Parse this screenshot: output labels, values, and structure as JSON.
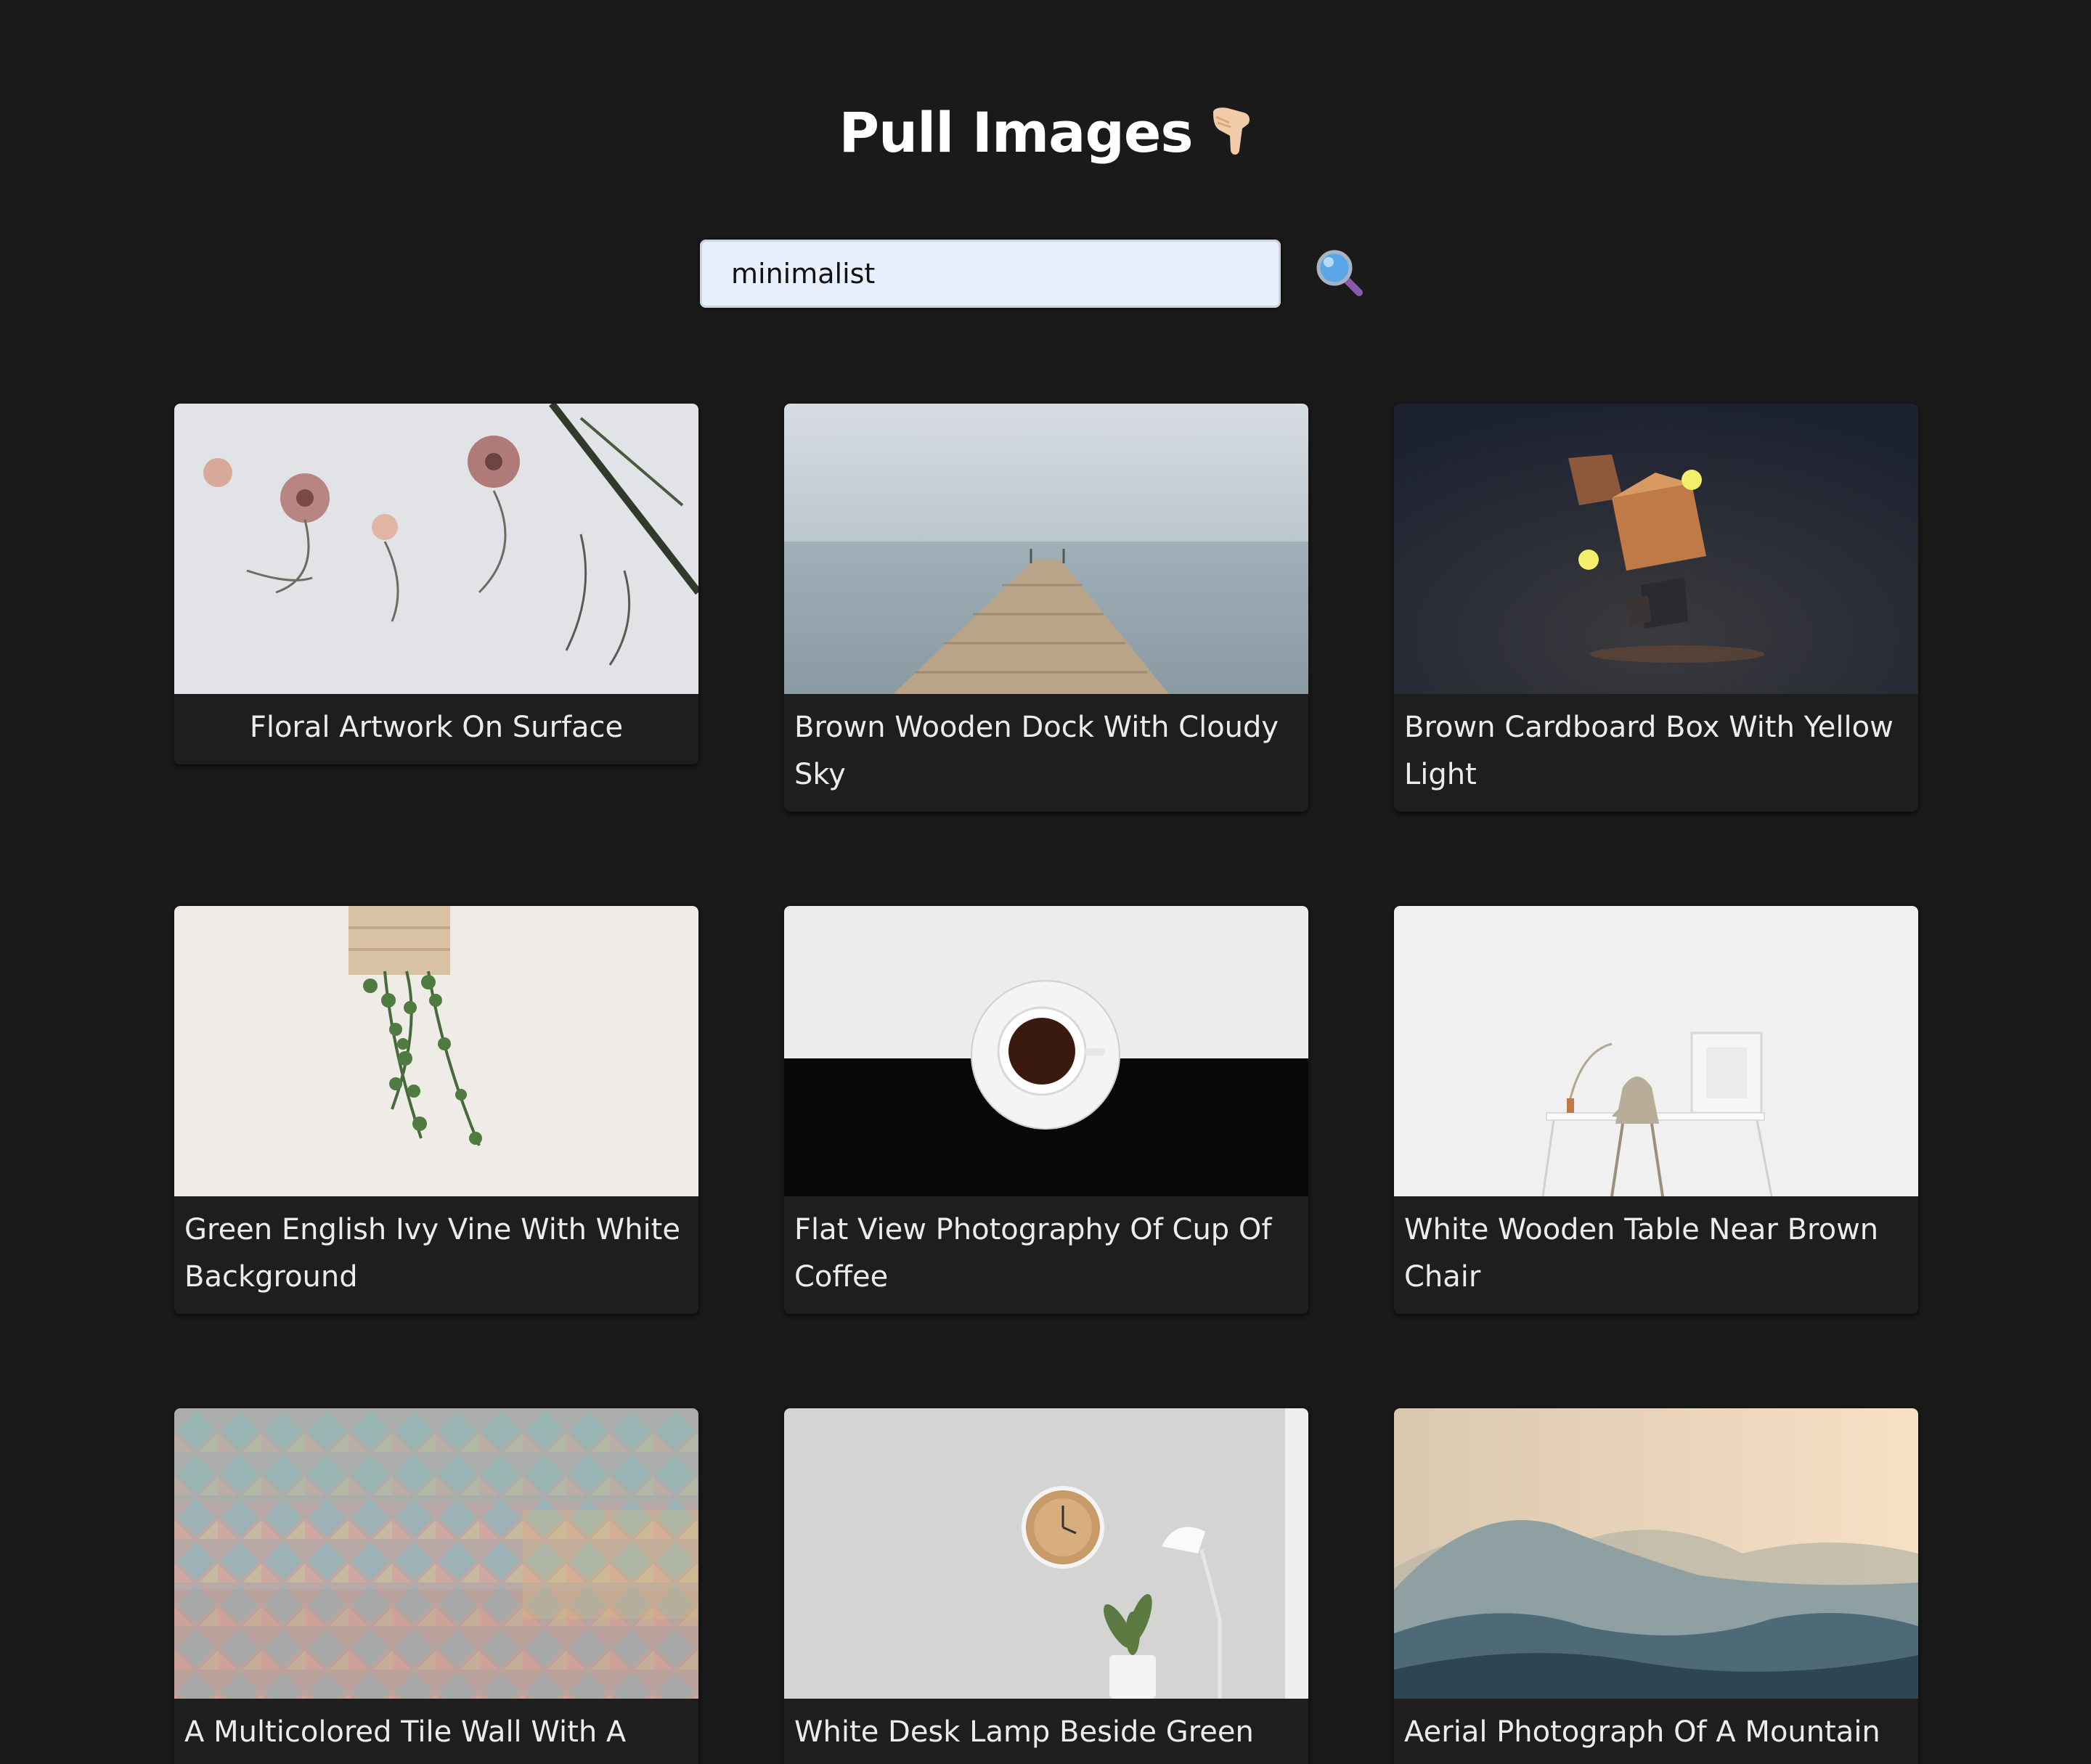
{
  "header": {
    "title": "Pull Images",
    "title_icon": "pointing-down-hand-icon"
  },
  "search": {
    "value": "minimalist",
    "button_icon": "magnifying-glass-icon"
  },
  "colors": {
    "background": "#1a1a1a",
    "input_background": "#e8f0fe",
    "text": "#ececec"
  },
  "cards": [
    {
      "caption": "Floral Artwork On Surface"
    },
    {
      "caption": "Brown Wooden Dock With Cloudy Sky"
    },
    {
      "caption": "Brown Cardboard Box With Yellow Light"
    },
    {
      "caption": "Green English Ivy Vine With White Background"
    },
    {
      "caption": "Flat View Photography Of Cup Of Coffee"
    },
    {
      "caption": "White Wooden Table Near Brown Chair"
    },
    {
      "caption": "A Multicolored Tile Wall With A"
    },
    {
      "caption": "White Desk Lamp Beside Green"
    },
    {
      "caption": "Aerial Photograph Of A Mountain"
    }
  ]
}
